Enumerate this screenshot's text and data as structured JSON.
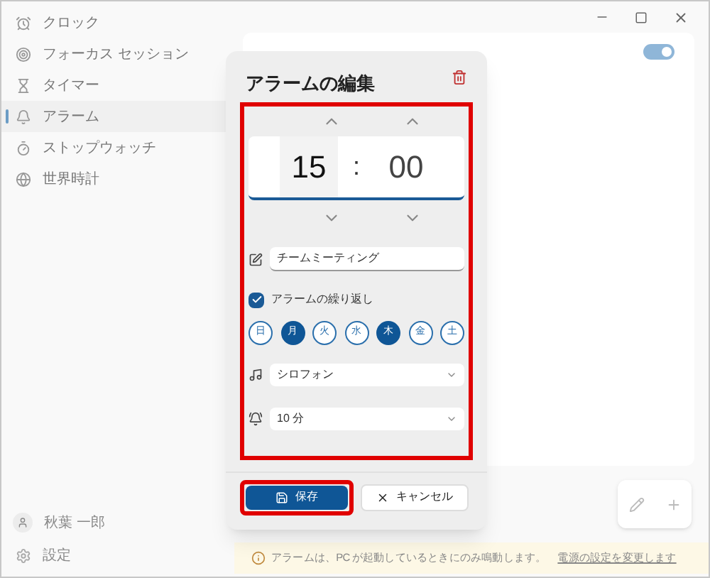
{
  "sidebar": {
    "items": [
      {
        "label": "クロック",
        "selected": false
      },
      {
        "label": "フォーカス セッション",
        "selected": false
      },
      {
        "label": "タイマー",
        "selected": false
      },
      {
        "label": "アラーム",
        "selected": true
      },
      {
        "label": "ストップウォッチ",
        "selected": false
      },
      {
        "label": "世界時計",
        "selected": false
      }
    ],
    "user": "秋葉 一郎",
    "settings": "設定"
  },
  "alarm_toggle": {
    "on": true
  },
  "dialog": {
    "title": "アラームの編集",
    "hour": "15",
    "separator": ":",
    "minute": "00",
    "name": "チームミーティング",
    "repeat": {
      "label": "アラームの繰り返し",
      "checked": true
    },
    "days": [
      {
        "label": "日",
        "selected": false
      },
      {
        "label": "月",
        "selected": true
      },
      {
        "label": "火",
        "selected": false
      },
      {
        "label": "水",
        "selected": false
      },
      {
        "label": "木",
        "selected": true
      },
      {
        "label": "金",
        "selected": false
      },
      {
        "label": "土",
        "selected": false
      }
    ],
    "sound": "シロフォン",
    "snooze": "10 分",
    "save": "保存",
    "cancel": "キャンセル"
  },
  "banner": {
    "text": "アラームは、PC が起動しているときにのみ鳴動します。",
    "link": "電源の設定を変更します"
  }
}
